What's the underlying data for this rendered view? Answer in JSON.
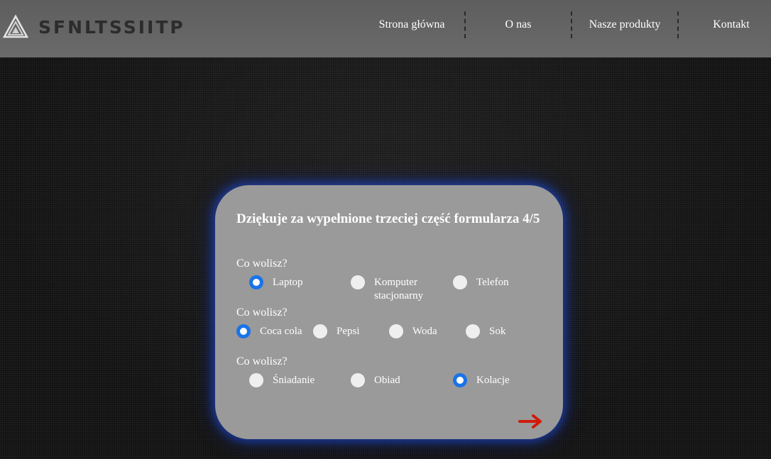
{
  "header": {
    "logo_text": "SFNLTSSIITP",
    "nav": [
      {
        "label": "Strona główna"
      },
      {
        "label": "O nas"
      },
      {
        "label": "Nasze produkty"
      },
      {
        "label": "Kontakt"
      }
    ]
  },
  "form": {
    "title": "Dziękuje za wypełnione trzeciej część formularza 4/5",
    "questions": [
      {
        "label": "Co wolisz?",
        "options": [
          {
            "label": "Laptop",
            "checked": true
          },
          {
            "label": "Komputer stacjonarny",
            "checked": false
          },
          {
            "label": "Telefon",
            "checked": false
          }
        ]
      },
      {
        "label": "Co wolisz?",
        "options": [
          {
            "label": "Coca cola",
            "checked": true
          },
          {
            "label": "Pepsi",
            "checked": false
          },
          {
            "label": "Woda",
            "checked": false
          },
          {
            "label": "Sok",
            "checked": false
          }
        ]
      },
      {
        "label": "Co wolisz?",
        "options": [
          {
            "label": "Śniadanie",
            "checked": false
          },
          {
            "label": "Obiad",
            "checked": false
          },
          {
            "label": "Kolacje",
            "checked": true
          }
        ]
      }
    ],
    "next_icon": "arrow-right-icon"
  },
  "colors": {
    "accent_radio": "#1a74e8",
    "card_glow": "#1e46c8",
    "next_arrow": "#d11a0a",
    "card_bg": "#9a9a9a",
    "header_bg": "#656565"
  }
}
